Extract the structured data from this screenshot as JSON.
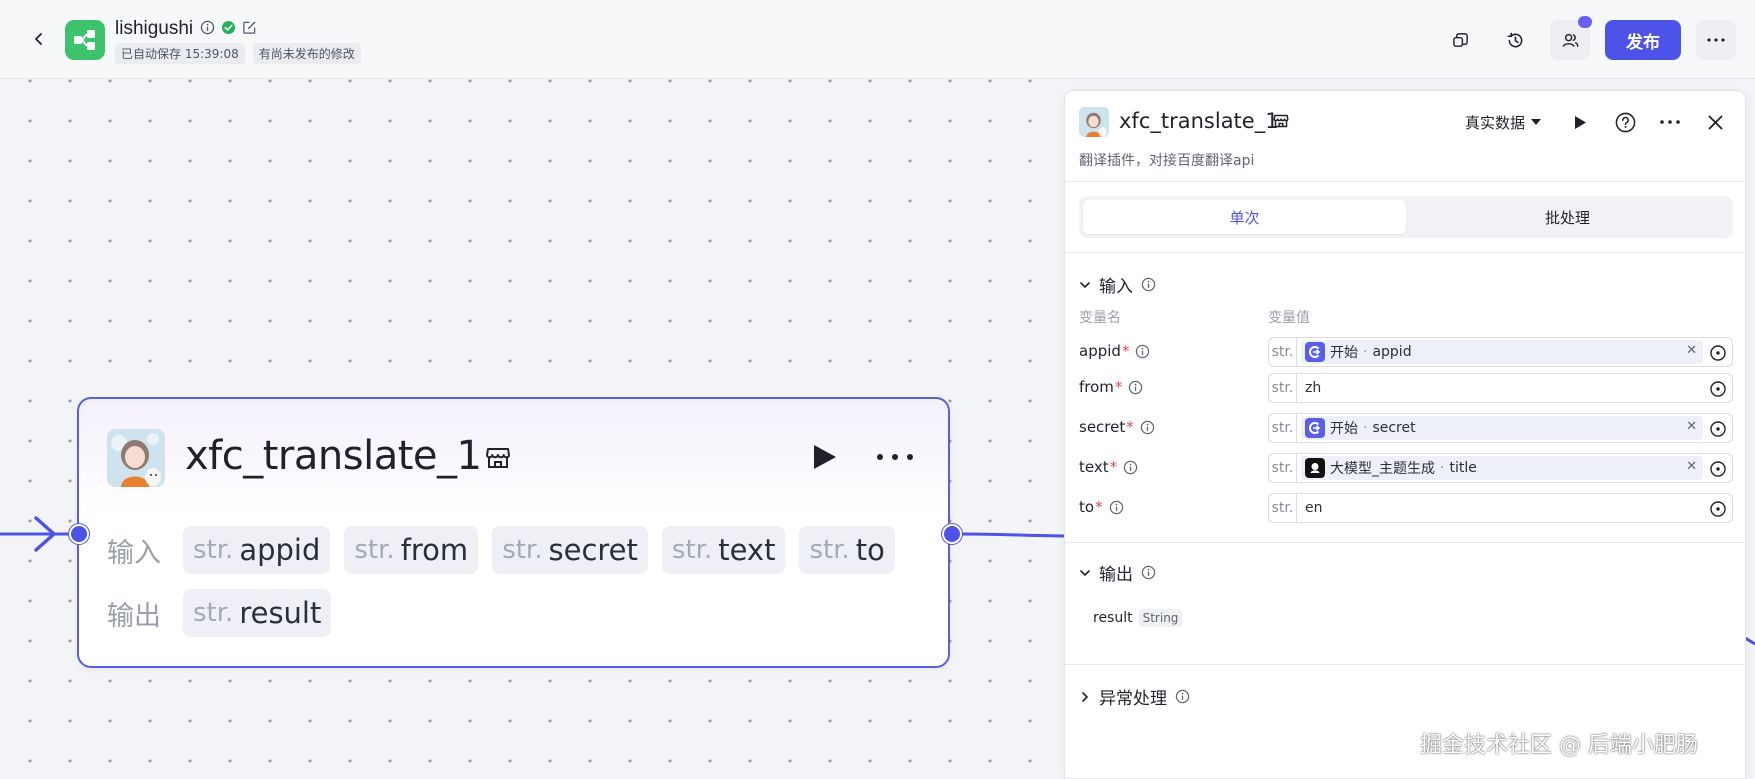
{
  "header": {
    "app_name": "lishigushi",
    "autosave": "已自动保存 15:39:08",
    "unpublished": "有尚未发布的修改",
    "publish_label": "发布"
  },
  "node": {
    "title": "xfc_translate_1",
    "input_label": "输入",
    "output_label": "输出",
    "inputs": [
      {
        "type": "str.",
        "name": "appid"
      },
      {
        "type": "str.",
        "name": "from"
      },
      {
        "type": "str.",
        "name": "secret"
      },
      {
        "type": "str.",
        "name": "text"
      },
      {
        "type": "str.",
        "name": "to"
      }
    ],
    "outputs": [
      {
        "type": "str.",
        "name": "result"
      }
    ]
  },
  "panel": {
    "title": "xfc_translate_1",
    "description": "翻译插件，对接百度翻译api",
    "mode_label": "真实数据",
    "tabs": [
      {
        "label": "单次",
        "active": true
      },
      {
        "label": "批处理",
        "active": false
      }
    ],
    "input_section": "输入",
    "col_name": "变量名",
    "col_value": "变量值",
    "variables": [
      {
        "name": "appid",
        "type": "str.",
        "source": "开始",
        "sep": "·",
        "ref": "appid",
        "source_icon": "start-icon"
      },
      {
        "name": "from",
        "type": "str.",
        "value": "zh"
      },
      {
        "name": "secret",
        "type": "str.",
        "source": "开始",
        "sep": "·",
        "ref": "secret",
        "source_icon": "start-icon"
      },
      {
        "name": "text",
        "type": "str.",
        "source": "大模型_主题生成",
        "sep": "·",
        "ref": "title",
        "source_icon": "llm-icon"
      },
      {
        "name": "to",
        "type": "str.",
        "value": "en"
      }
    ],
    "output_section": "输出",
    "output": {
      "name": "result",
      "type": "String"
    },
    "exception_section": "异常处理"
  },
  "watermark": "掘金技术社区 @ 后端小肥肠",
  "colors": {
    "accent": "#4d53e8",
    "logo_green": "#3cc36b",
    "required": "#e5484d"
  }
}
